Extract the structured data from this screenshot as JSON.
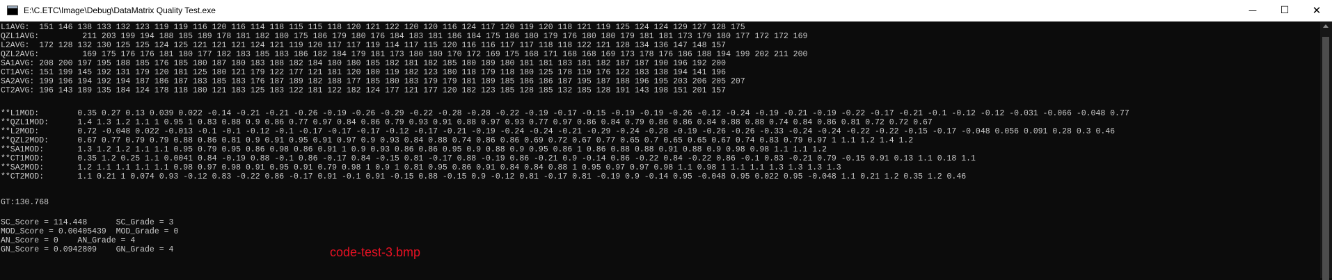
{
  "window": {
    "title": "E:\\C.ETC\\Image\\Debug\\DataMatrix Quality Test.exe",
    "app_icon": "console-window-icon",
    "controls": {
      "minimize": "—",
      "maximize": "☐",
      "close": "✕"
    }
  },
  "console": {
    "lines": [
      "L1AVG:  151 146 138 133 132 123 119 119 116 120 116 114 118 115 115 118 120 121 122 120 120 116 124 117 120 119 120 118 121 119 125 124 124 129 127 128 175",
      "QZL1AVG:         211 203 199 194 188 185 189 178 181 182 180 175 186 179 180 176 184 183 181 186 184 175 186 180 179 176 180 180 179 181 181 173 179 180 177 172 172 169",
      "L2AVG:  172 128 132 130 125 125 124 125 121 121 121 124 121 119 120 117 117 119 114 117 115 120 116 116 117 117 118 118 122 121 128 134 136 147 148 157",
      "QZL2AVG:         169 175 176 176 181 180 177 182 183 185 183 186 182 184 179 181 173 180 180 170 172 169 175 168 171 168 168 169 173 178 176 186 188 194 199 202 211 200",
      "SA1AVG: 208 200 197 195 188 185 176 185 180 187 180 183 188 182 184 180 180 185 182 181 182 185 180 189 180 181 181 183 181 182 187 187 190 196 192 200",
      "CT1AVG: 151 199 145 192 131 179 120 181 125 180 121 179 122 177 121 181 120 180 119 182 123 180 118 179 118 180 125 178 119 176 122 183 138 194 141 196",
      "SA2AVG: 199 196 194 192 194 187 186 187 183 185 183 176 187 189 182 188 177 185 180 183 179 179 181 189 185 186 186 187 195 187 188 196 195 203 206 205 207",
      "CT2AVG: 196 143 189 135 184 124 178 118 180 121 183 125 183 122 181 122 182 124 177 121 177 120 182 123 185 128 185 132 185 128 191 143 198 151 201 157",
      "",
      "**L1MOD:        0.35 0.27 0.13 0.039 0.022 -0.14 -0.21 -0.21 -0.26 -0.19 -0.26 -0.29 -0.22 -0.28 -0.28 -0.22 -0.19 -0.17 -0.15 -0.19 -0.19 -0.26 -0.12 -0.24 -0.19 -0.21 -0.19 -0.22 -0.17 -0.21 -0.1 -0.12 -0.12 -0.031 -0.066 -0.048 0.77",
      "**QZL1MOD:      1.4 1.3 1.2 1.1 1 0.95 1 0.83 0.88 0.9 0.86 0.77 0.97 0.84 0.86 0.79 0.93 0.91 0.88 0.97 0.93 0.77 0.97 0.86 0.84 0.79 0.86 0.86 0.84 0.88 0.88 0.74 0.84 0.86 0.81 0.72 0.72 0.67",
      "**L2MOD:        0.72 -0.048 0.022 -0.013 -0.1 -0.1 -0.12 -0.1 -0.17 -0.17 -0.17 -0.12 -0.17 -0.21 -0.19 -0.24 -0.24 -0.21 -0.29 -0.24 -0.28 -0.19 -0.26 -0.26 -0.33 -0.24 -0.24 -0.22 -0.22 -0.15 -0.17 -0.048 0.056 0.091 0.28 0.3 0.46",
      "**QZL2MOD:      0.67 0.77 0.79 0.79 0.88 0.86 0.81 0.9 0.91 0.95 0.91 0.97 0.9 0.93 0.84 0.88 0.74 0.86 0.86 0.69 0.72 0.67 0.77 0.65 0.7 0.65 0.65 0.67 0.74 0.83 0.79 0.97 1 1.1 1.2 1.4 1.2",
      "**SA1MOD:       1.3 1.2 1.2 1.1 1.1 0.95 0.79 0.95 0.86 0.98 0.86 0.91 1 0.9 0.93 0.86 0.86 0.95 0.9 0.88 0.9 0.95 0.86 1 0.86 0.88 0.88 0.91 0.88 0.9 0.98 0.98 1.1 1.1 1.2",
      "**CT1MOD:       0.35 1.2 0.25 1.1 0.0041 0.84 -0.19 0.88 -0.1 0.86 -0.17 0.84 -0.15 0.81 -0.17 0.88 -0.19 0.86 -0.21 0.9 -0.14 0.86 -0.22 0.84 -0.22 0.86 -0.1 0.83 -0.21 0.79 -0.15 0.91 0.13 1.1 0.18 1.1",
      "**SA2MOD:       1.2 1.1 1.1 1.1 1.1 0.98 0.97 0.98 0.91 0.95 0.91 0.79 0.98 1 0.9 1 0.81 0.95 0.86 0.91 0.84 0.84 0.88 1 0.95 0.97 0.97 0.98 1.1 0.98 1 1.1 1.1 1.3 1.3 1.3 1.3",
      "**CT2MOD:       1.1 0.21 1 0.074 0.93 -0.12 0.83 -0.22 0.86 -0.17 0.91 -0.1 0.91 -0.15 0.88 -0.15 0.9 -0.12 0.81 -0.17 0.81 -0.19 0.9 -0.14 0.95 -0.048 0.95 0.022 0.95 -0.048 1.1 0.21 1.2 0.35 1.2 0.46",
      "",
      "GT:130.768",
      "",
      "SC_Score = 114.448      SC_Grade = 3",
      "MOD_Score = 0.00405439  MOD_Grade = 0",
      "AN_Score = 0    AN_Grade = 4",
      "GN_Score = 0.0942809    GN_Grade = 4"
    ],
    "filename_label": "code-test-3.bmp"
  }
}
